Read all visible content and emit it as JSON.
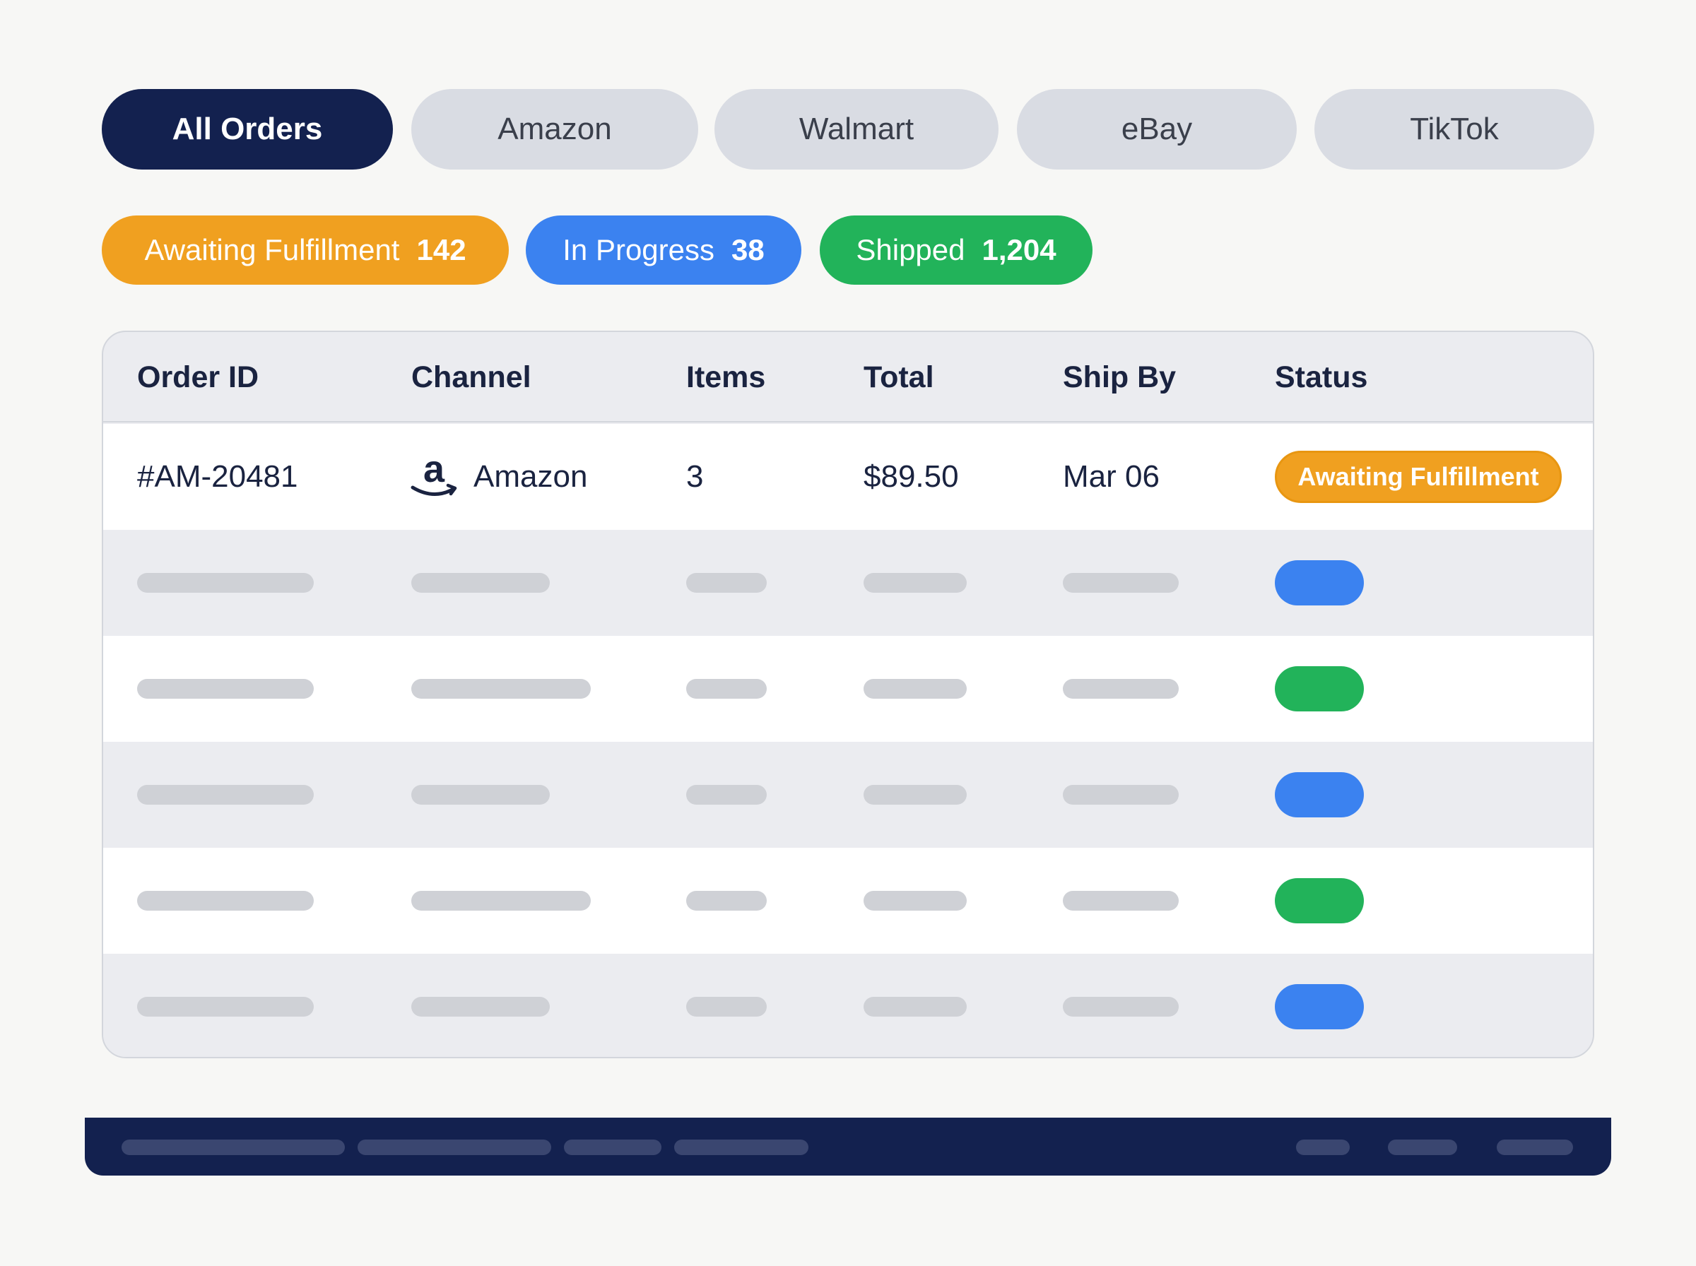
{
  "channel_tabs": [
    {
      "label": "All Orders",
      "active": true
    },
    {
      "label": "Amazon",
      "active": false
    },
    {
      "label": "Walmart",
      "active": false
    },
    {
      "label": "eBay",
      "active": false
    },
    {
      "label": "TikTok",
      "active": false
    }
  ],
  "status_filters": [
    {
      "label": "Awaiting Fulfillment",
      "count": "142",
      "color": "#f0a020"
    },
    {
      "label": "In Progress",
      "count": "38",
      "color": "#3b82f0"
    },
    {
      "label": "Shipped",
      "count": "1,204",
      "color": "#22b35a"
    }
  ],
  "table": {
    "columns": [
      "Order ID",
      "Channel",
      "Items",
      "Total",
      "Ship By",
      "Status"
    ],
    "rows": [
      {
        "order_id": "#AM-20481",
        "channel": "Amazon",
        "channel_icon": "amazon-logo-icon",
        "items": "3",
        "total": "$89.50",
        "ship_by": "Mar 06",
        "status": "Awaiting Fulfillment",
        "status_color": "#f0a020"
      }
    ],
    "placeholder_row_status_colors": [
      "#3b82f0",
      "#22b35a",
      "#3b82f0",
      "#22b35a",
      "#3b82f0"
    ]
  },
  "colors": {
    "navy": "#13214f",
    "awaiting": "#f0a020",
    "in_progress": "#3b82f0",
    "shipped": "#22b35a"
  }
}
